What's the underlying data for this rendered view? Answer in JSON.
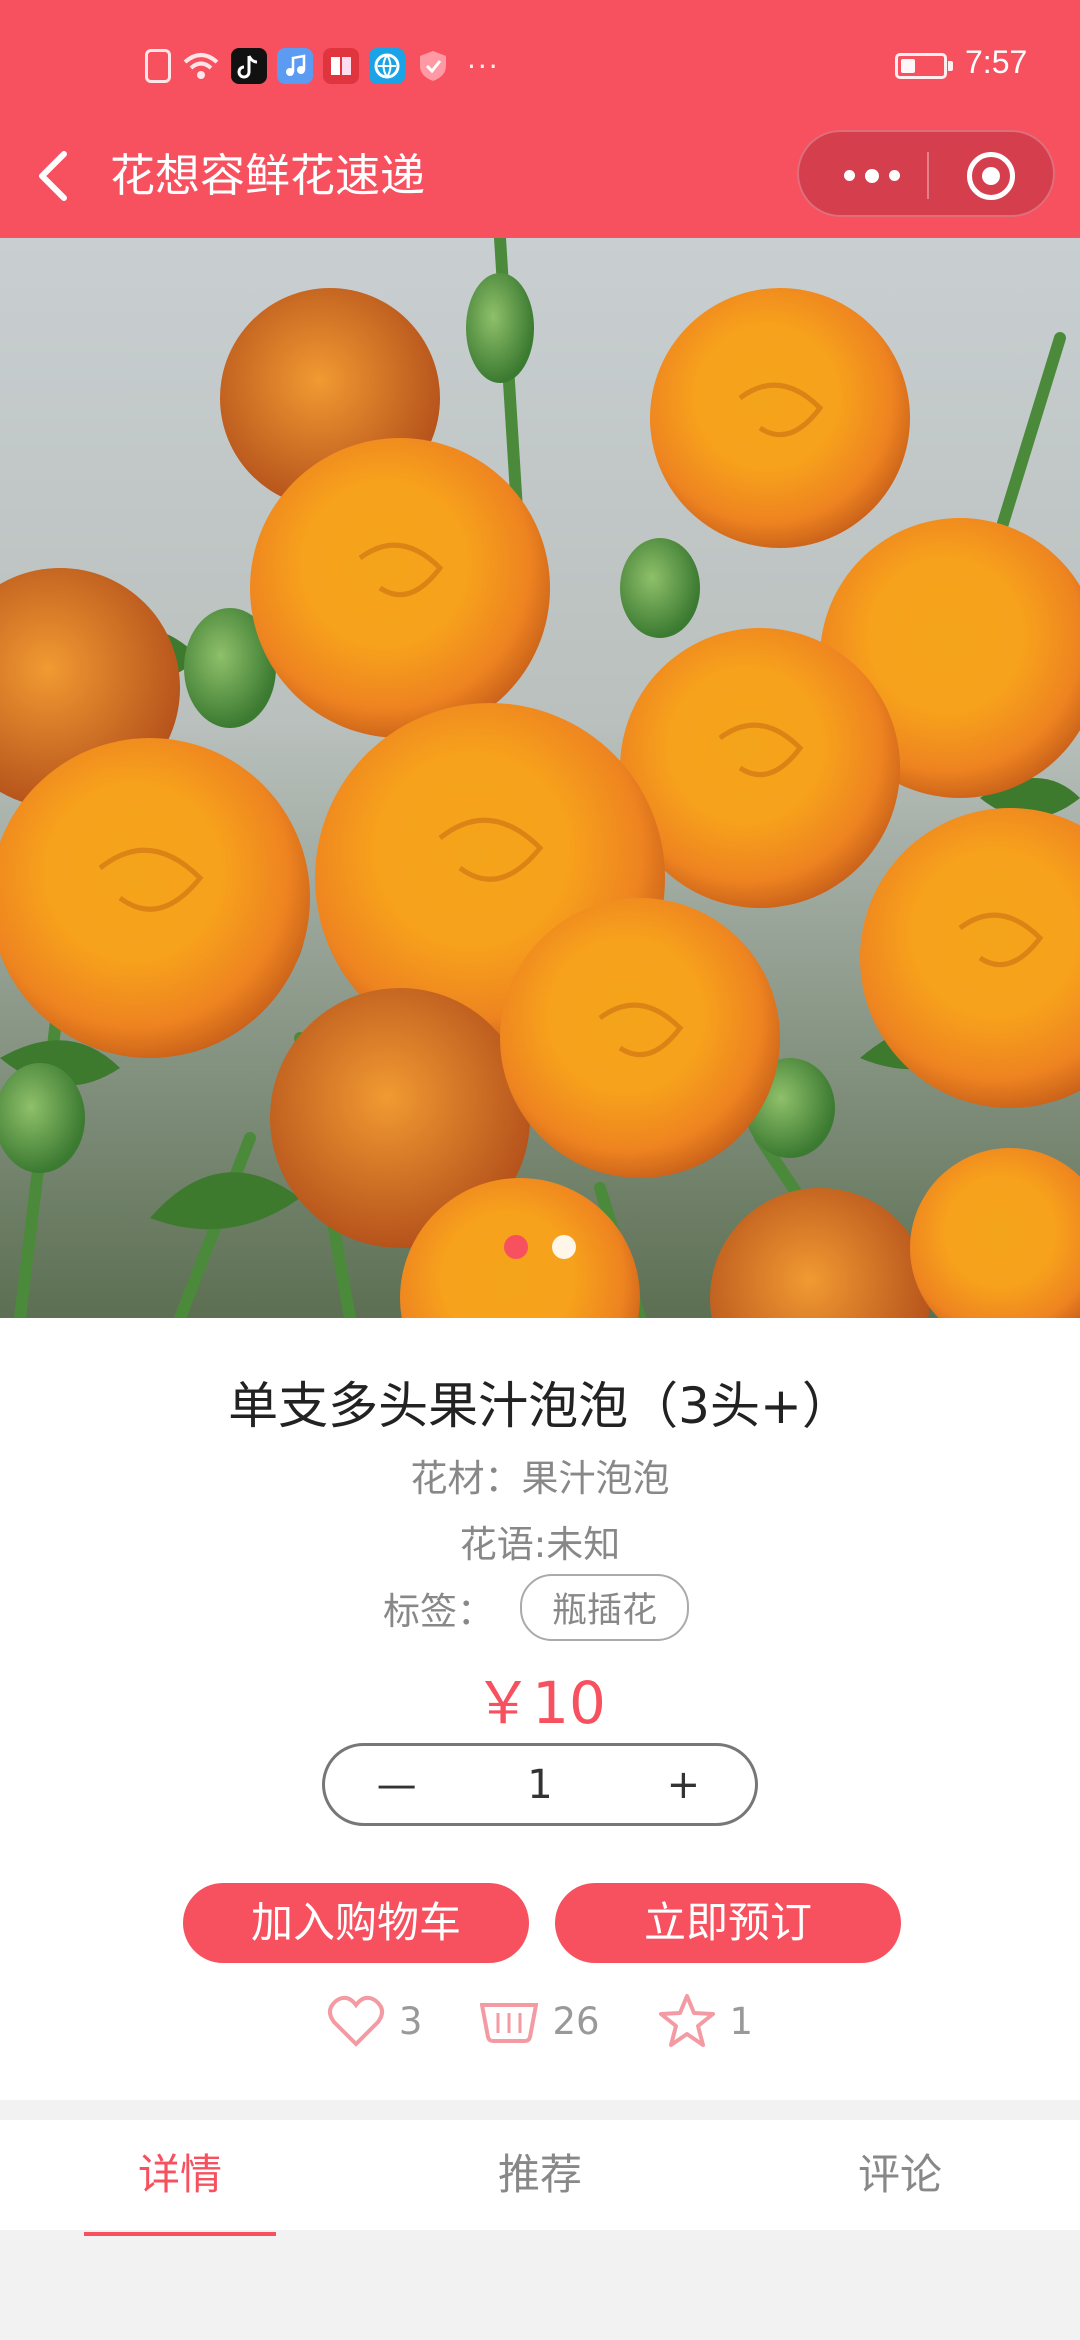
{
  "status_bar": {
    "time": "7:57",
    "icons": [
      "sim-icon",
      "wifi-icon",
      "tiktok-app-icon",
      "music-app-icon",
      "reader-app-icon",
      "browser-app-icon",
      "shield-app-icon"
    ],
    "more": "···"
  },
  "nav": {
    "title": "花想容鲜花速递",
    "back_icon": "chevron-left-icon",
    "more_icon": "ellipsis-icon",
    "close_icon": "target-icon"
  },
  "carousel": {
    "image_description": "orange spray roses",
    "slide_count": 2,
    "active_index": 0
  },
  "product": {
    "title": "单支多头果汁泡泡（3头+）",
    "material": "花材：果汁泡泡",
    "language": "花语:未知",
    "tag_label": "标签：",
    "tags": [
      "瓶插花"
    ],
    "price": "￥10",
    "quantity": "1",
    "minus": "—",
    "plus": "+"
  },
  "actions": {
    "add_to_cart": "加入购物车",
    "book_now": "立即预订"
  },
  "stats": {
    "likes": "3",
    "sold": "26",
    "favorites": "1"
  },
  "tabs": [
    {
      "label": "详情",
      "active": true
    },
    {
      "label": "推荐",
      "active": false
    },
    {
      "label": "评论",
      "active": false
    }
  ],
  "colors": {
    "brand": "#f7505f",
    "muted": "#888888"
  }
}
